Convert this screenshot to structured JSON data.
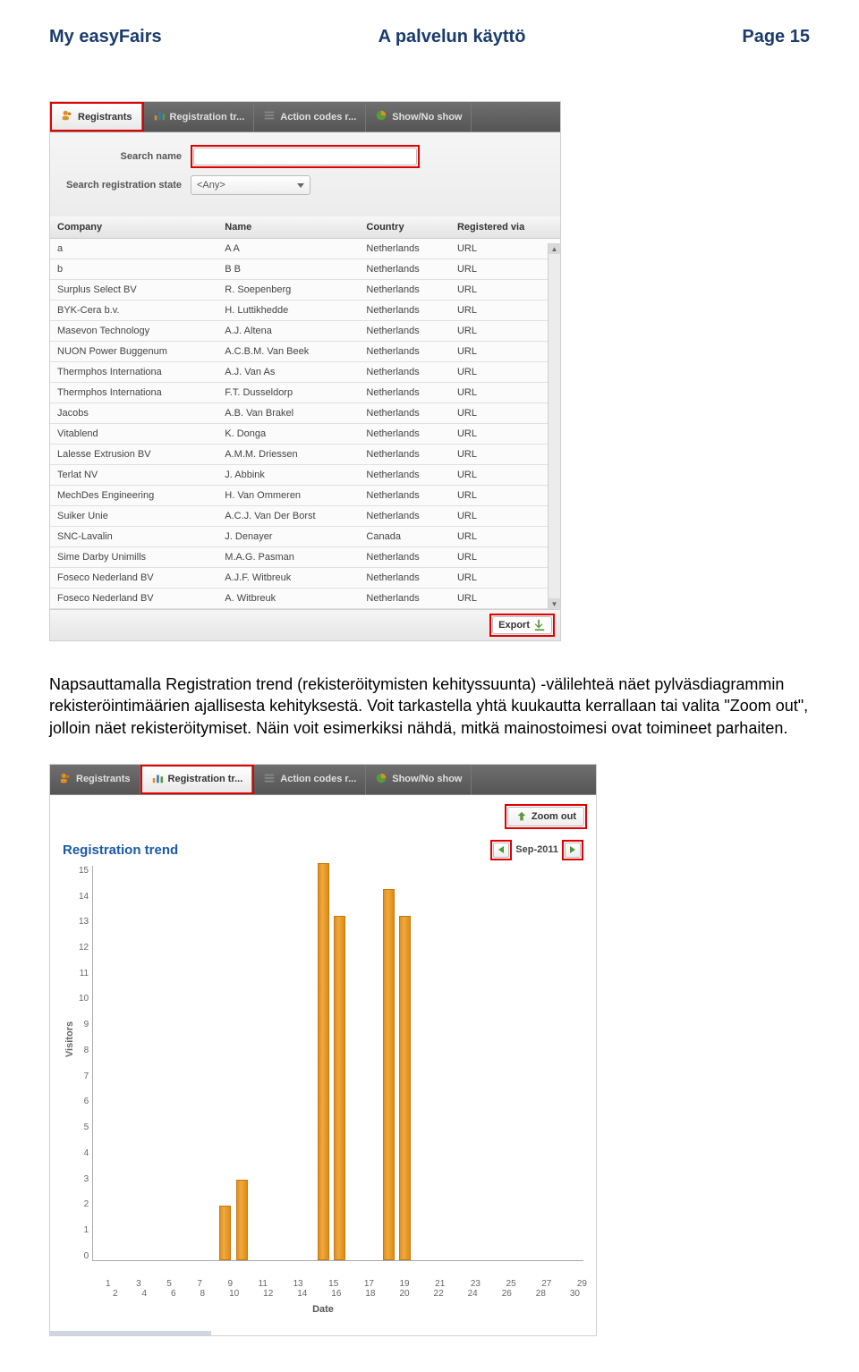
{
  "header": {
    "left": "My easyFairs",
    "center": "A palvelun käyttö",
    "right": "Page 15"
  },
  "screenshot1": {
    "tabs": [
      {
        "label": "Registrants",
        "icon": "users-icon",
        "active": true,
        "highlighted": true
      },
      {
        "label": "Registration tr...",
        "icon": "bars-icon",
        "active": false,
        "highlighted": false
      },
      {
        "label": "Action codes r...",
        "icon": "list-icon",
        "active": false,
        "highlighted": false
      },
      {
        "label": "Show/No show",
        "icon": "pie-icon",
        "active": false,
        "highlighted": false
      }
    ],
    "search": {
      "name_label": "Search name",
      "state_label": "Search registration state",
      "state_value": "<Any>"
    },
    "columns": [
      "Company",
      "Name",
      "Country",
      "Registered via"
    ],
    "rows": [
      {
        "company": "a",
        "name": "A A",
        "country": "Netherlands",
        "via": "URL"
      },
      {
        "company": "b",
        "name": "B B",
        "country": "Netherlands",
        "via": "URL"
      },
      {
        "company": "Surplus Select BV",
        "name": "R. Soepenberg",
        "country": "Netherlands",
        "via": "URL"
      },
      {
        "company": "BYK-Cera b.v.",
        "name": "H. Luttikhedde",
        "country": "Netherlands",
        "via": "URL"
      },
      {
        "company": "Masevon Technology",
        "name": "A.J. Altena",
        "country": "Netherlands",
        "via": "URL"
      },
      {
        "company": "NUON Power Buggenum",
        "name": "A.C.B.M. Van Beek",
        "country": "Netherlands",
        "via": "URL"
      },
      {
        "company": "Thermphos Internationa",
        "name": "A.J. Van As",
        "country": "Netherlands",
        "via": "URL"
      },
      {
        "company": "Thermphos Internationa",
        "name": "F.T. Dusseldorp",
        "country": "Netherlands",
        "via": "URL"
      },
      {
        "company": "Jacobs",
        "name": "A.B. Van Brakel",
        "country": "Netherlands",
        "via": "URL"
      },
      {
        "company": "Vitablend",
        "name": "K. Donga",
        "country": "Netherlands",
        "via": "URL"
      },
      {
        "company": "Lalesse Extrusion BV",
        "name": "A.M.M. Driessen",
        "country": "Netherlands",
        "via": "URL"
      },
      {
        "company": "Terlat NV",
        "name": "J. Abbink",
        "country": "Netherlands",
        "via": "URL"
      },
      {
        "company": "MechDes Engineering",
        "name": "H. Van Ommeren",
        "country": "Netherlands",
        "via": "URL"
      },
      {
        "company": "Suiker Unie",
        "name": "A.C.J. Van Der Borst",
        "country": "Netherlands",
        "via": "URL"
      },
      {
        "company": "SNC-Lavalin",
        "name": "J. Denayer",
        "country": "Canada",
        "via": "URL"
      },
      {
        "company": "Sime Darby Unimills",
        "name": "M.A.G. Pasman",
        "country": "Netherlands",
        "via": "URL"
      },
      {
        "company": "Foseco Nederland BV",
        "name": "A.J.F. Witbreuk",
        "country": "Netherlands",
        "via": "URL"
      },
      {
        "company": "Foseco Nederland BV",
        "name": "A. Witbreuk",
        "country": "Netherlands",
        "via": "URL"
      }
    ],
    "export_label": "Export"
  },
  "body_text": "Napsauttamalla Registration trend (rekisteröitymisten kehityssuunta) -välilehteä näet pylväsdiagrammin rekisteröintimäärien ajallisesta kehityksestä. Voit tarkastella yhtä kuukautta kerrallaan tai valita \"Zoom out\", jolloin näet rekisteröitymiset. Näin voit esimerkiksi nähdä, mitkä mainostoimesi ovat toimineet parhaiten.",
  "screenshot2": {
    "tabs": [
      {
        "label": "Registrants",
        "icon": "users-icon",
        "active": false,
        "highlighted": false
      },
      {
        "label": "Registration tr...",
        "icon": "bars-icon",
        "active": true,
        "highlighted": true
      },
      {
        "label": "Action codes r...",
        "icon": "list-icon",
        "active": false,
        "highlighted": false
      },
      {
        "label": "Show/No show",
        "icon": "pie-icon",
        "active": false,
        "highlighted": false
      }
    ],
    "zoom_label": "Zoom out",
    "chart_title": "Registration trend",
    "month_label": "Sep-2011",
    "xlabel": "Date",
    "ylabel": "Visitors"
  },
  "chart_data": {
    "type": "bar",
    "title": "Registration trend",
    "xlabel": "Date",
    "ylabel": "Visitors",
    "ylim": [
      0,
      15
    ],
    "x_start": 1,
    "x_end": 30,
    "month": "Sep-2011",
    "series": [
      {
        "name": "Visitors",
        "points": [
          {
            "x": 9,
            "y": 2
          },
          {
            "x": 10,
            "y": 3
          },
          {
            "x": 15,
            "y": 15
          },
          {
            "x": 16,
            "y": 13
          },
          {
            "x": 19,
            "y": 14
          },
          {
            "x": 20,
            "y": 13
          }
        ]
      }
    ]
  }
}
